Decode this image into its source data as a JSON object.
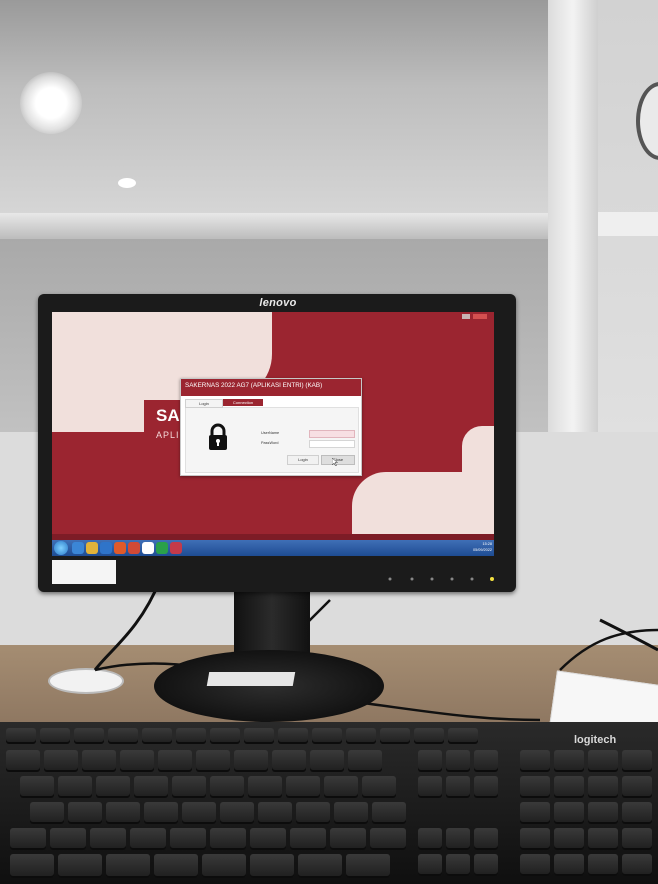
{
  "monitor": {
    "brand": "lenovo"
  },
  "app_screen": {
    "big_title_fragment": "SA",
    "big_subtitle_fragment": "APLI",
    "dialog": {
      "title": "SAKERNAS 2022 AG7 (APLIKASI ENTRI) (KAB)",
      "tabs": [
        "Login",
        "Connection"
      ],
      "username_label": "UserName",
      "password_label": "PassWord",
      "login_button": "Login",
      "close_button": "Close"
    }
  },
  "taskbar": {
    "clock_time": "15:28",
    "clock_date": "05/09/2022"
  },
  "keyboard": {
    "brand": "logitech"
  },
  "colors": {
    "app_red": "#9b2530",
    "app_shape": "#f1e0dc",
    "taskbar_blue": "#1e4c93"
  },
  "icons": [
    "lock-icon",
    "start-button-icon",
    "mouse-cursor-icon"
  ]
}
